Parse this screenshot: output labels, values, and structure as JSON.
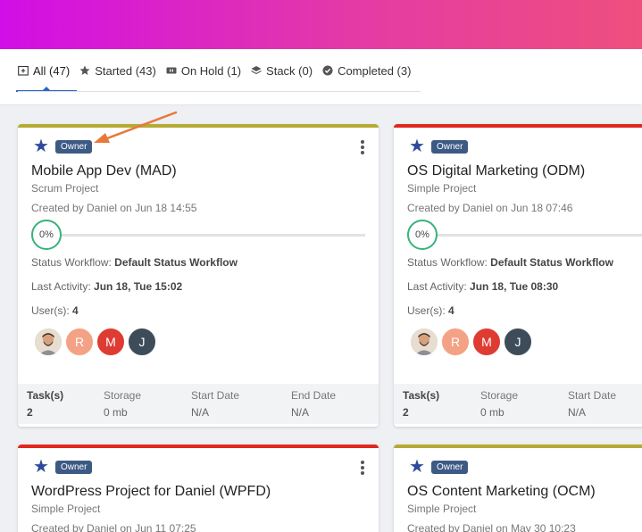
{
  "tabs": [
    {
      "label": "All (47)",
      "icon": "folder-plus-icon"
    },
    {
      "label": "Started (43)",
      "icon": "star-icon"
    },
    {
      "label": "On Hold (1)",
      "icon": "pause-icon"
    },
    {
      "label": "Stack (0)",
      "icon": "layers-icon"
    },
    {
      "label": "Completed (3)",
      "icon": "check-circle-icon"
    }
  ],
  "colors": {
    "accent_blue": "#2a66c8",
    "owner_badge": "#3d5a85",
    "progress": "#3ab27a",
    "olive_line": "#b5ab34",
    "red_line": "#e0281e"
  },
  "cards": [
    {
      "badge": "Owner",
      "title": "Mobile App Dev  (MAD)",
      "type": "Scrum Project",
      "created": "Created by Daniel on Jun 18 14:55",
      "progress_label": "0%",
      "progress": 0,
      "workflow_label": "Status Workflow:",
      "workflow_value": "Default Status Workflow",
      "activity_label": "Last Activity:",
      "activity_value": "Jun 18, Tue 15:02",
      "users_label": "User(s):",
      "users_value": "4",
      "avatars": [
        "R",
        "M",
        "J"
      ],
      "footer": {
        "tasks_h": "Task(s)",
        "tasks_v": "2",
        "storage_h": "Storage",
        "storage_v": "0 mb",
        "start_h": "Start Date",
        "start_v": "N/A",
        "end_h": "End Date",
        "end_v": "N/A"
      }
    },
    {
      "badge": "Owner",
      "title": "OS Digital Marketing  (ODM)",
      "type": "Simple Project",
      "created": "Created by Daniel on Jun 18 07:46",
      "progress_label": "0%",
      "progress": 0,
      "workflow_label": "Status Workflow:",
      "workflow_value": "Default Status Workflow",
      "activity_label": "Last Activity:",
      "activity_value": "Jun 18, Tue 08:30",
      "users_label": "User(s):",
      "users_value": "4",
      "avatars": [
        "R",
        "M",
        "J"
      ],
      "footer": {
        "tasks_h": "Task(s)",
        "tasks_v": "2",
        "storage_h": "Storage",
        "storage_v": "0 mb",
        "start_h": "Start Date",
        "start_v": "N/A"
      }
    },
    {
      "badge": "Owner",
      "title": "WordPress Project for Daniel  (WPFD)",
      "type": "Simple Project",
      "created": "Created by Daniel on Jun 11 07:25"
    },
    {
      "badge": "Owner",
      "title": "OS Content Marketing  (OCM)",
      "type": "Simple Project",
      "created": "Created by Daniel on May 30 10:23"
    }
  ]
}
